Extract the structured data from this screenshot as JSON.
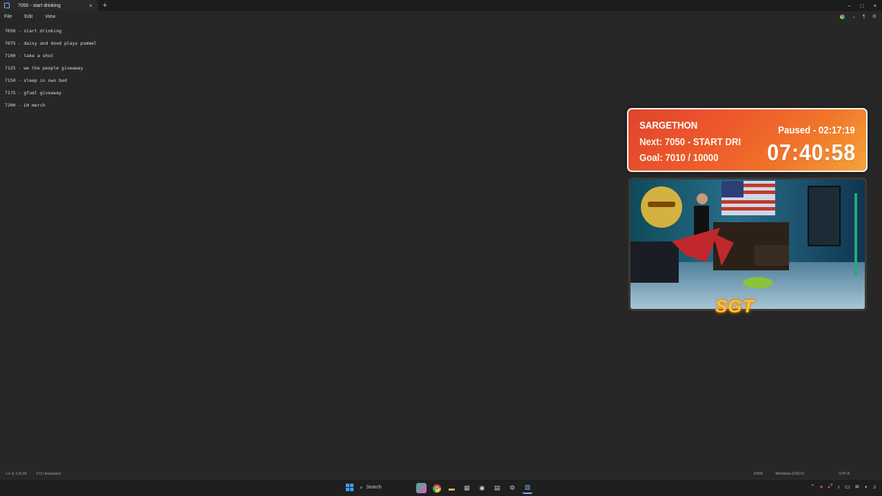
{
  "window": {
    "tab_title": "7050 - start drinking",
    "tab_close": "×",
    "new_tab": "+",
    "controls": [
      "–",
      "□",
      "×"
    ]
  },
  "menu": {
    "items": [
      "File",
      "Edit",
      "View"
    ]
  },
  "editor": {
    "lines": [
      "7050 - start drinking",
      "7075 - daisy and dood plays pummel",
      "7100 - take a shot",
      "7125 - we the people giveaway",
      "7150 - sleep in own bed",
      "7175 - gfuel giveaway",
      "7200 - LH merch"
    ]
  },
  "status": {
    "position": "Ln 3, Col 35",
    "characters": "173 characters",
    "zoom": "100%",
    "line_ending": "Windows (CRLF)",
    "encoding": "UTF-8"
  },
  "taskbar": {
    "search_label": "Search",
    "icons": [
      "copilot-icon",
      "chrome-icon",
      "file-explorer-icon",
      "calculator-icon",
      "obs-icon",
      "notes-icon",
      "settings-icon",
      "notepad-icon"
    ]
  },
  "overlay": {
    "title": "SARGETHON",
    "next": "Next: 7050 - START DRI",
    "goal": "Goal: 7010 / 10000",
    "paused": "Paused - 02:17:19",
    "timer": "07:40:58",
    "logo": "SGT"
  },
  "colors": {
    "background": "#272727",
    "overlay_orange": "#ee5a2b",
    "overlay_yellow": "#f6a33a",
    "logo_yellow": "#ffc42a"
  }
}
